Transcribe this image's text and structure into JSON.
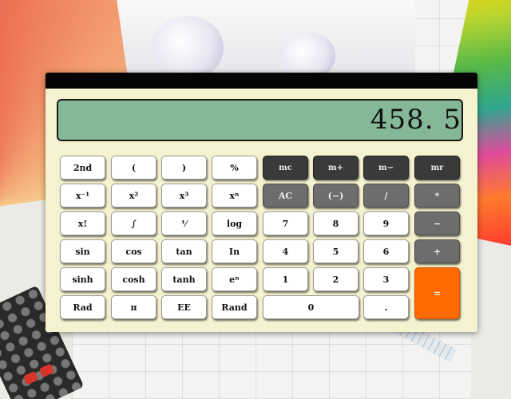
{
  "display": {
    "value": "458. 5"
  },
  "keys": {
    "row1": [
      "2nd",
      "(",
      ")",
      "%",
      "mc",
      "m+",
      "m−",
      "mr"
    ],
    "row2": [
      "x⁻¹",
      "x²",
      "x³",
      "xⁿ",
      "AC",
      "(−)",
      "/",
      "*"
    ],
    "row3": [
      "x!",
      "∫",
      "⅟",
      "log",
      "7",
      "8",
      "9",
      "−"
    ],
    "row4": [
      "sin",
      "cos",
      "tan",
      "In",
      "4",
      "5",
      "6",
      "+"
    ],
    "row5": [
      "sinh",
      "cosh",
      "tanh",
      "eⁿ",
      "1",
      "2",
      "3",
      "="
    ],
    "row6": [
      "Rad",
      "π",
      "EE",
      "Rand",
      "0",
      "."
    ]
  }
}
